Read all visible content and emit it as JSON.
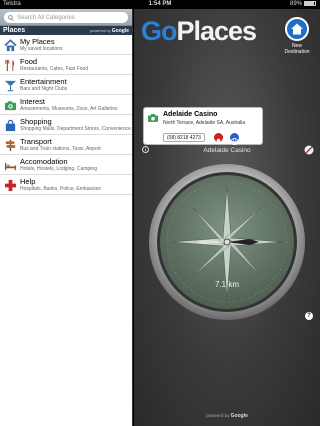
{
  "status": {
    "carrier": "Telstra",
    "time": "1:54 PM",
    "battery": "89%"
  },
  "search": {
    "placeholder": "Search All Categories"
  },
  "sidebar": {
    "header": "Places",
    "powered_by": "powered by",
    "powered_brand": "Google",
    "categories": [
      {
        "title": "My Places",
        "subtitle": "My saved locations",
        "icon": "house-icon"
      },
      {
        "title": "Food",
        "subtitle": "Restaurants, Cafes, Fast Food",
        "icon": "fork-knife-icon"
      },
      {
        "title": "Entertainment",
        "subtitle": "Bars and Night Clubs",
        "icon": "cocktail-icon"
      },
      {
        "title": "Interest",
        "subtitle": "Amusements, Museums, Zoos, Art Galleries",
        "icon": "camera-icon"
      },
      {
        "title": "Shopping",
        "subtitle": "Shopping Malls, Department Stores, Convenience Sto...",
        "icon": "shopping-bag-icon"
      },
      {
        "title": "Transport",
        "subtitle": "Bus and Train stations, Taxis, Airport",
        "icon": "signpost-icon"
      },
      {
        "title": "Accomodation",
        "subtitle": "Hotels, Hostels, Lodging, Camping",
        "icon": "bed-icon"
      },
      {
        "title": "Help",
        "subtitle": "Hospitals, Banks, Police, Embassies",
        "icon": "red-cross-icon"
      }
    ]
  },
  "main": {
    "logo_go": "Go",
    "logo_places": "Places",
    "new_destination": "New Destination",
    "card": {
      "name": "Adelaide Casino",
      "address": "North Terrace, Adelaide SA, Australia",
      "phone": "(08) 8218 4273"
    },
    "destination_label": "Adelaide Casino",
    "distance": "7.1 km",
    "powered_by": "powered by",
    "powered_brand": "Google"
  },
  "colors": {
    "accent_blue": "#2e7fd6",
    "sidebar_header": "#2c3a4d",
    "compass_green": "#6a7f6e"
  }
}
